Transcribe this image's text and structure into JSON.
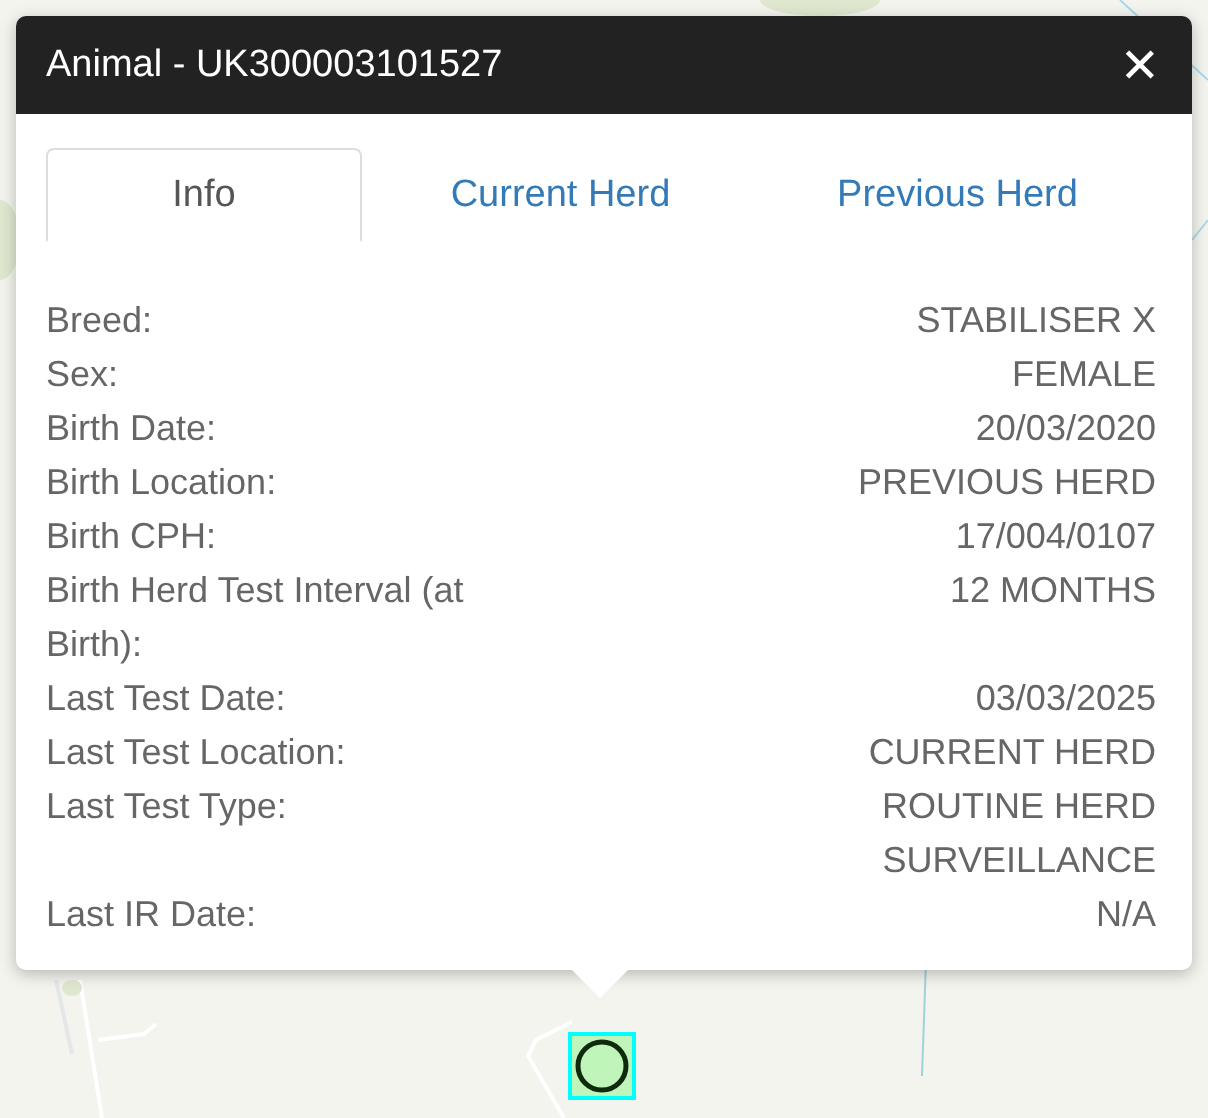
{
  "popup": {
    "title": "Animal - UK300003101527",
    "close": "✕",
    "tabs": [
      {
        "label": "Info",
        "selected": true
      },
      {
        "label": "Current Herd",
        "selected": false
      },
      {
        "label": "Previous Herd",
        "selected": false
      }
    ],
    "fields": [
      {
        "label": "Breed:",
        "value": "STABILISER X"
      },
      {
        "label": "Sex:",
        "value": "FEMALE"
      },
      {
        "label": "Birth Date:",
        "value": "20/03/2020"
      },
      {
        "label": "Birth Location:",
        "value": "PREVIOUS HERD"
      },
      {
        "label": "Birth CPH:",
        "value": "17/004/0107"
      },
      {
        "label": "Birth Herd Test Interval (at Birth):",
        "value": "12 MONTHS"
      },
      {
        "label": "Last Test Date:",
        "value": "03/03/2025"
      },
      {
        "label": "Last Test Location:",
        "value": "CURRENT HERD"
      },
      {
        "label": "Last Test Type:",
        "value": "ROUTINE HERD SURVEILLANCE"
      },
      {
        "label": "Last IR Date:",
        "value": "N/A"
      }
    ]
  }
}
